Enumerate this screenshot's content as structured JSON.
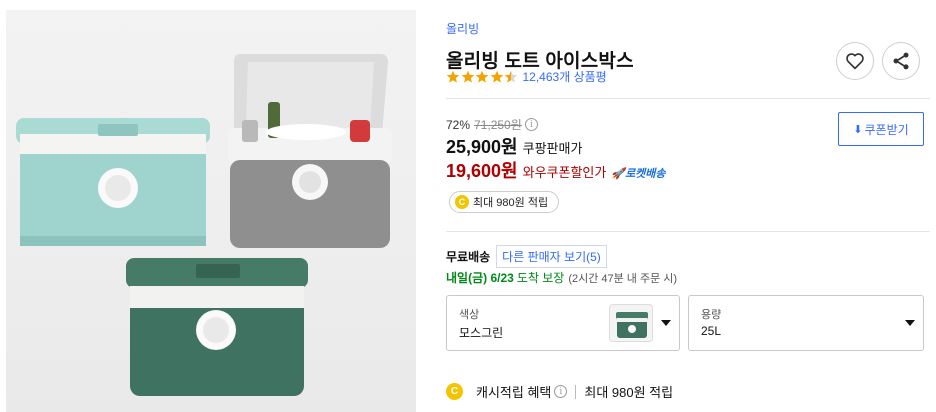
{
  "product": {
    "brand": "올리빙",
    "title": "올리빙 도트 아이스박스",
    "rating": 4.5,
    "review_count": "12,463개 상품평"
  },
  "price": {
    "discount": "72%",
    "original": "71,250원",
    "sale": "25,900원",
    "sale_type": "쿠팡판매가",
    "wow": "19,600원",
    "wow_type": "와우쿠폰할인가",
    "rocket": "로켓배송",
    "coupon_button": "쿠폰받기"
  },
  "cashback": {
    "badge": "최대 980원 적립",
    "benefit_label": "캐시적립 혜택",
    "benefit_value": "최대 980원 적립"
  },
  "shipping": {
    "free": "무료배송",
    "other_sellers": "다른 판매자 보기(5)",
    "arrival": "내일(금) 6/23",
    "arrival_note": "도착 보장",
    "order_note": "(2시간 47분 내 주문 시)"
  },
  "options": {
    "color_label": "색상",
    "color_value": "모스그린",
    "size_label": "용량",
    "size_value": "25L"
  },
  "colors": {
    "link": "#346aff",
    "wow": "#ae0000",
    "arrival": "#00891a"
  }
}
